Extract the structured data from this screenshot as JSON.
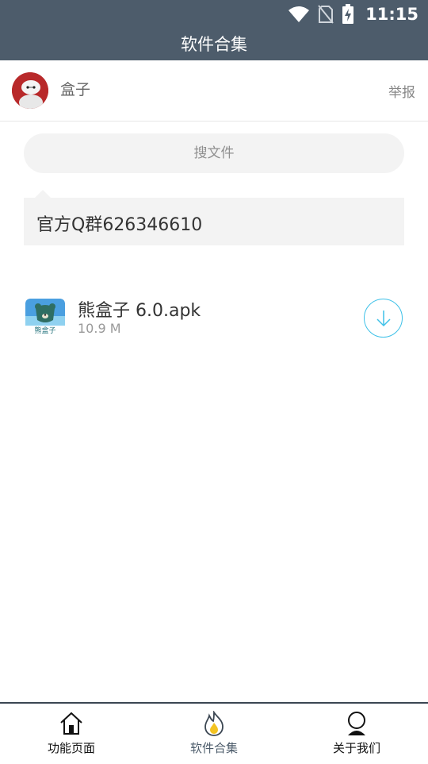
{
  "status_bar": {
    "time": "11:15",
    "icons": [
      "wifi-icon",
      "no-sim-icon",
      "battery-charging-icon"
    ]
  },
  "title_bar": {
    "title": "软件合集"
  },
  "owner": {
    "name": "盒子",
    "report_label": "举报",
    "avatar_icon": "avatar-robot"
  },
  "search": {
    "label": "搜文件"
  },
  "notice": {
    "text": "官方Q群626346610"
  },
  "files": [
    {
      "name": "熊盒子 6.0.apk",
      "size": "10.9 M",
      "icon_caption": "熊盒子",
      "icon": "app-bear-icon",
      "action_icon": "download-icon"
    }
  ],
  "bottom_nav": {
    "items": [
      {
        "label": "功能页面",
        "icon": "home-icon",
        "active": false
      },
      {
        "label": "软件合集",
        "icon": "fire-icon",
        "active": true
      },
      {
        "label": "关于我们",
        "icon": "person-icon",
        "active": false
      }
    ]
  },
  "colors": {
    "header_bg": "#4d5c6b",
    "accent": "#3ec1e8",
    "nav_border": "#3b4652",
    "search_bg": "#f3f3f3"
  }
}
